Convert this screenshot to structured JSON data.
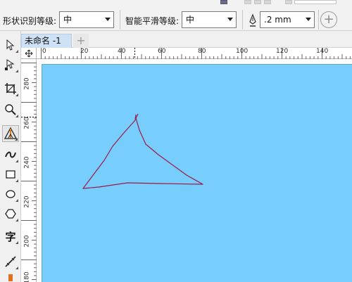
{
  "property_bar": {
    "shape_recognition_label": "形状识别等级:",
    "shape_recognition_value": "中",
    "smoothing_label": "智能平滑等级:",
    "smoothing_value": "中",
    "outline_width": ".2 mm"
  },
  "document": {
    "tab_title": "未命名 -1",
    "add_tab": "+"
  },
  "rulers": {
    "top_ticks": [
      "0",
      "20",
      "40",
      "60",
      "80",
      "100",
      "120",
      "140"
    ],
    "left_ticks": [
      "280",
      "260",
      "240",
      "220",
      "200",
      "180"
    ]
  },
  "colors": {
    "page_background": "#77cdfb",
    "stroke": "#9b1b4a"
  },
  "icons": {
    "toolbox": [
      "pick-tool-icon",
      "shape-tool-icon",
      "crop-tool-icon",
      "zoom-tool-icon",
      "smart-drawing-tool-icon",
      "artistic-media-icon",
      "rectangle-tool-icon",
      "ellipse-tool-icon",
      "polygon-tool-icon",
      "text-tool-icon",
      "dimension-tool-icon"
    ]
  },
  "text_tool_glyph": "字"
}
